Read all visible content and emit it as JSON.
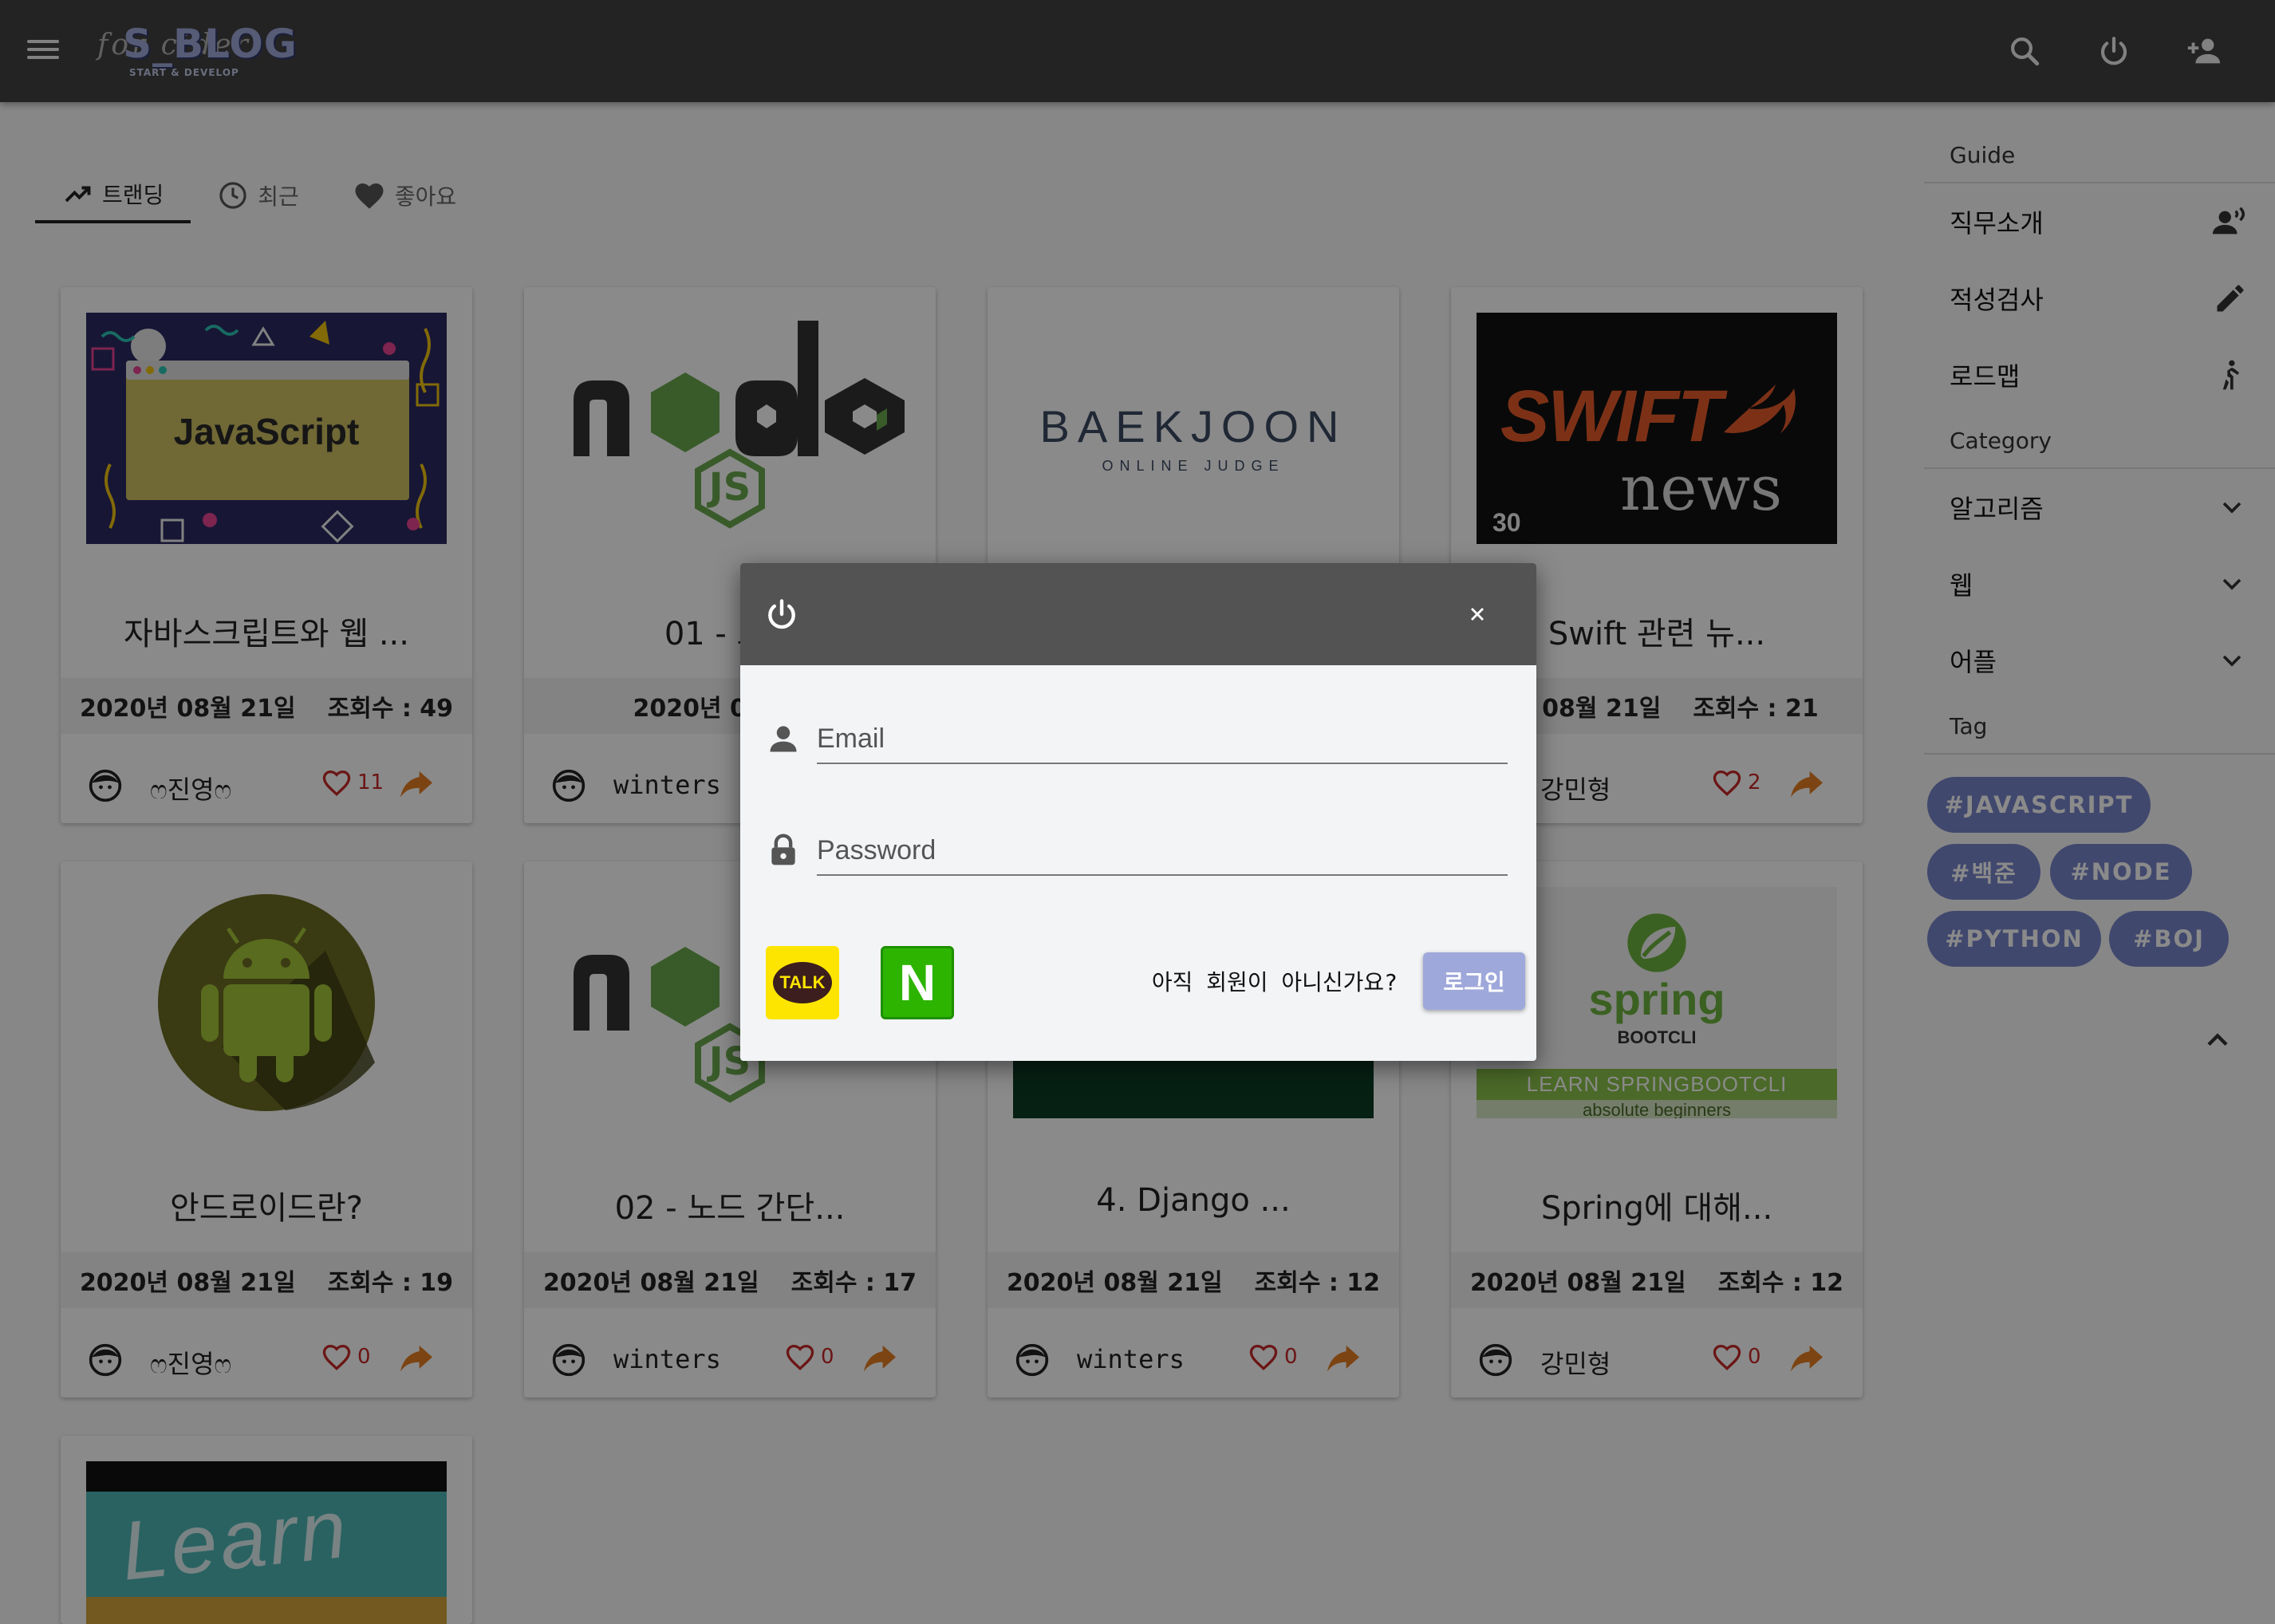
{
  "header": {
    "logo_script": "for cider",
    "logo_name": "S_BLOG",
    "logo_sub": "START & DEVELOP",
    "icons": [
      "menu-icon",
      "search-icon",
      "power-icon",
      "person-add-icon"
    ]
  },
  "tabs": [
    {
      "label": "트랜딩",
      "icon": "trending-up-icon",
      "active": true
    },
    {
      "label": "최근",
      "icon": "clock-icon",
      "active": false
    },
    {
      "label": "좋아요",
      "icon": "heart-icon",
      "active": false
    }
  ],
  "cards": [
    {
      "title": "자바스크립트와 웹 ...",
      "date": "2020년 08월 21일",
      "views": "조회수 : 49",
      "author": "ෆ진영ෆ",
      "likes": "11",
      "thumb": "javascript",
      "thumb_text": "JavaScript"
    },
    {
      "title": "01 - 노드",
      "date": "2020년 08월 21",
      "views": "",
      "author": "winters",
      "likes": "",
      "thumb": "node"
    },
    {
      "title": "",
      "date": "",
      "views": "",
      "author": "",
      "likes": "",
      "thumb": "baekjoon",
      "thumb_text": "BAEKJOON",
      "thumb_sub": "ONLINE JUDGE"
    },
    {
      "title": "Swift 관련 뉴...",
      "date": "0년 08월 21일",
      "views": "조회수 : 21",
      "author": "강민형",
      "likes": "2",
      "thumb": "swift",
      "thumb_text": "SWIFT",
      "thumb_sub": "news",
      "thumb_num": "30"
    },
    {
      "title": "안드로이드란?",
      "date": "2020년 08월 21일",
      "views": "조회수 : 19",
      "author": "ෆ진영ෆ",
      "likes": "0",
      "thumb": "android"
    },
    {
      "title": "02 - 노드 간단...",
      "date": "2020년 08월 21일",
      "views": "조회수 : 17",
      "author": "winters",
      "likes": "0",
      "thumb": "node"
    },
    {
      "title": "4. Django ...",
      "date": "2020년 08월 21일",
      "views": "조회수 : 12",
      "author": "winters",
      "likes": "0",
      "thumb": "django"
    },
    {
      "title": "Spring에 대해...",
      "date": "2020년 08월 21일",
      "views": "조회수 : 12",
      "author": "강민형",
      "likes": "0",
      "thumb": "spring",
      "thumb_text": "spring",
      "thumb_sub": "BOOTCLI",
      "thumb_banner": "LEARN SPRINGBOOTCLI",
      "thumb_banner2": "absolute beginners"
    },
    {
      "title": "",
      "date": "",
      "views": "",
      "author": "",
      "likes": "",
      "thumb": "learn",
      "thumb_text": "Learn"
    }
  ],
  "sidebar": {
    "guide_label": "Guide",
    "guide_items": [
      {
        "label": "직무소개",
        "icon": "record-voice-icon"
      },
      {
        "label": "적성검사",
        "icon": "pencil-icon"
      },
      {
        "label": "로드맵",
        "icon": "walking-person-icon"
      }
    ],
    "category_label": "Category",
    "category_items": [
      {
        "label": "알고리즘",
        "icon": "chevron-down-icon"
      },
      {
        "label": "웹",
        "icon": "chevron-down-icon"
      },
      {
        "label": "어플",
        "icon": "chevron-down-icon"
      }
    ],
    "tag_label": "Tag",
    "tags": [
      "#JAVASCRIPT",
      "#백준",
      "#NODE",
      "#PYTHON",
      "#BOJ"
    ]
  },
  "dialog": {
    "email_placeholder": "Email",
    "password_placeholder": "Password",
    "kakao_label": "TALK",
    "naver_label": "N",
    "signup_text": "아직 회원이 아니신가요?",
    "login_label": "로그인"
  },
  "colors": {
    "appbar": "#424242",
    "accent": "#7986cb",
    "login_button": "#9fa8da",
    "like": "#c62828",
    "share": "#e67e22",
    "kakao": "#fee500",
    "naver": "#2db400"
  }
}
